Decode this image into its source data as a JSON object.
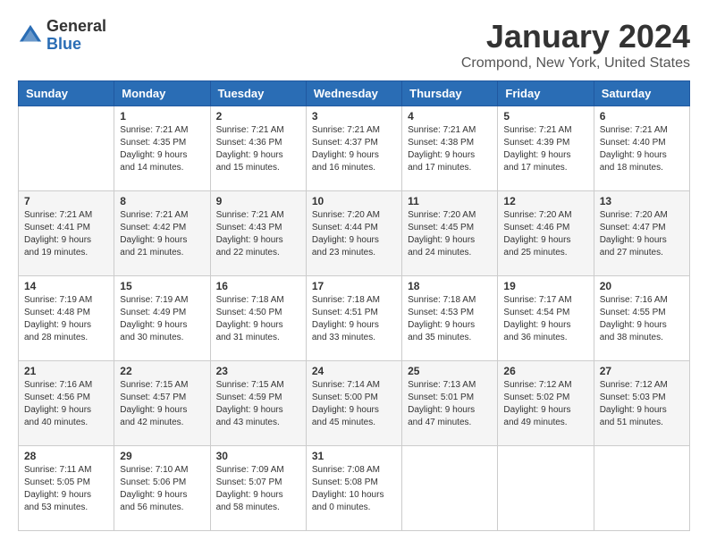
{
  "header": {
    "logo_general": "General",
    "logo_blue": "Blue",
    "title": "January 2024",
    "location": "Crompond, New York, United States"
  },
  "weekdays": [
    "Sunday",
    "Monday",
    "Tuesday",
    "Wednesday",
    "Thursday",
    "Friday",
    "Saturday"
  ],
  "weeks": [
    [
      {
        "day": "",
        "info": ""
      },
      {
        "day": "1",
        "info": "Sunrise: 7:21 AM\nSunset: 4:35 PM\nDaylight: 9 hours\nand 14 minutes."
      },
      {
        "day": "2",
        "info": "Sunrise: 7:21 AM\nSunset: 4:36 PM\nDaylight: 9 hours\nand 15 minutes."
      },
      {
        "day": "3",
        "info": "Sunrise: 7:21 AM\nSunset: 4:37 PM\nDaylight: 9 hours\nand 16 minutes."
      },
      {
        "day": "4",
        "info": "Sunrise: 7:21 AM\nSunset: 4:38 PM\nDaylight: 9 hours\nand 17 minutes."
      },
      {
        "day": "5",
        "info": "Sunrise: 7:21 AM\nSunset: 4:39 PM\nDaylight: 9 hours\nand 17 minutes."
      },
      {
        "day": "6",
        "info": "Sunrise: 7:21 AM\nSunset: 4:40 PM\nDaylight: 9 hours\nand 18 minutes."
      }
    ],
    [
      {
        "day": "7",
        "info": "Sunrise: 7:21 AM\nSunset: 4:41 PM\nDaylight: 9 hours\nand 19 minutes."
      },
      {
        "day": "8",
        "info": "Sunrise: 7:21 AM\nSunset: 4:42 PM\nDaylight: 9 hours\nand 21 minutes."
      },
      {
        "day": "9",
        "info": "Sunrise: 7:21 AM\nSunset: 4:43 PM\nDaylight: 9 hours\nand 22 minutes."
      },
      {
        "day": "10",
        "info": "Sunrise: 7:20 AM\nSunset: 4:44 PM\nDaylight: 9 hours\nand 23 minutes."
      },
      {
        "day": "11",
        "info": "Sunrise: 7:20 AM\nSunset: 4:45 PM\nDaylight: 9 hours\nand 24 minutes."
      },
      {
        "day": "12",
        "info": "Sunrise: 7:20 AM\nSunset: 4:46 PM\nDaylight: 9 hours\nand 25 minutes."
      },
      {
        "day": "13",
        "info": "Sunrise: 7:20 AM\nSunset: 4:47 PM\nDaylight: 9 hours\nand 27 minutes."
      }
    ],
    [
      {
        "day": "14",
        "info": "Sunrise: 7:19 AM\nSunset: 4:48 PM\nDaylight: 9 hours\nand 28 minutes."
      },
      {
        "day": "15",
        "info": "Sunrise: 7:19 AM\nSunset: 4:49 PM\nDaylight: 9 hours\nand 30 minutes."
      },
      {
        "day": "16",
        "info": "Sunrise: 7:18 AM\nSunset: 4:50 PM\nDaylight: 9 hours\nand 31 minutes."
      },
      {
        "day": "17",
        "info": "Sunrise: 7:18 AM\nSunset: 4:51 PM\nDaylight: 9 hours\nand 33 minutes."
      },
      {
        "day": "18",
        "info": "Sunrise: 7:18 AM\nSunset: 4:53 PM\nDaylight: 9 hours\nand 35 minutes."
      },
      {
        "day": "19",
        "info": "Sunrise: 7:17 AM\nSunset: 4:54 PM\nDaylight: 9 hours\nand 36 minutes."
      },
      {
        "day": "20",
        "info": "Sunrise: 7:16 AM\nSunset: 4:55 PM\nDaylight: 9 hours\nand 38 minutes."
      }
    ],
    [
      {
        "day": "21",
        "info": "Sunrise: 7:16 AM\nSunset: 4:56 PM\nDaylight: 9 hours\nand 40 minutes."
      },
      {
        "day": "22",
        "info": "Sunrise: 7:15 AM\nSunset: 4:57 PM\nDaylight: 9 hours\nand 42 minutes."
      },
      {
        "day": "23",
        "info": "Sunrise: 7:15 AM\nSunset: 4:59 PM\nDaylight: 9 hours\nand 43 minutes."
      },
      {
        "day": "24",
        "info": "Sunrise: 7:14 AM\nSunset: 5:00 PM\nDaylight: 9 hours\nand 45 minutes."
      },
      {
        "day": "25",
        "info": "Sunrise: 7:13 AM\nSunset: 5:01 PM\nDaylight: 9 hours\nand 47 minutes."
      },
      {
        "day": "26",
        "info": "Sunrise: 7:12 AM\nSunset: 5:02 PM\nDaylight: 9 hours\nand 49 minutes."
      },
      {
        "day": "27",
        "info": "Sunrise: 7:12 AM\nSunset: 5:03 PM\nDaylight: 9 hours\nand 51 minutes."
      }
    ],
    [
      {
        "day": "28",
        "info": "Sunrise: 7:11 AM\nSunset: 5:05 PM\nDaylight: 9 hours\nand 53 minutes."
      },
      {
        "day": "29",
        "info": "Sunrise: 7:10 AM\nSunset: 5:06 PM\nDaylight: 9 hours\nand 56 minutes."
      },
      {
        "day": "30",
        "info": "Sunrise: 7:09 AM\nSunset: 5:07 PM\nDaylight: 9 hours\nand 58 minutes."
      },
      {
        "day": "31",
        "info": "Sunrise: 7:08 AM\nSunset: 5:08 PM\nDaylight: 10 hours\nand 0 minutes."
      },
      {
        "day": "",
        "info": ""
      },
      {
        "day": "",
        "info": ""
      },
      {
        "day": "",
        "info": ""
      }
    ]
  ]
}
